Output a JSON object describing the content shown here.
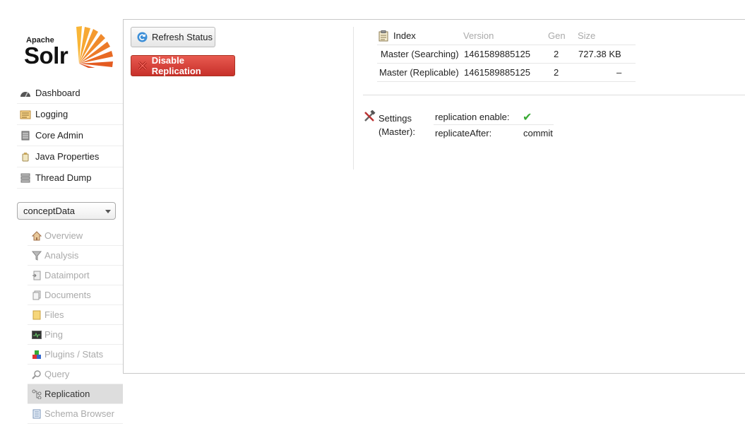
{
  "logo": {
    "apache": "Apache",
    "solr": "Solr"
  },
  "menu": [
    {
      "label": "Dashboard",
      "icon": "dashboard-icon"
    },
    {
      "label": "Logging",
      "icon": "logging-icon"
    },
    {
      "label": "Core Admin",
      "icon": "core-admin-icon"
    },
    {
      "label": "Java Properties",
      "icon": "java-properties-icon"
    },
    {
      "label": "Thread Dump",
      "icon": "thread-dump-icon"
    }
  ],
  "core_selector": {
    "value": "conceptData"
  },
  "core_menu": [
    {
      "label": "Overview",
      "icon": "home-icon"
    },
    {
      "label": "Analysis",
      "icon": "funnel-icon"
    },
    {
      "label": "Dataimport",
      "icon": "dataimport-icon"
    },
    {
      "label": "Documents",
      "icon": "documents-icon"
    },
    {
      "label": "Files",
      "icon": "folder-icon"
    },
    {
      "label": "Ping",
      "icon": "ping-icon"
    },
    {
      "label": "Plugins / Stats",
      "icon": "plugins-icon"
    },
    {
      "label": "Query",
      "icon": "search-icon"
    },
    {
      "label": "Replication",
      "icon": "replication-icon",
      "active": true
    },
    {
      "label": "Schema Browser",
      "icon": "schema-icon"
    }
  ],
  "buttons": {
    "refresh": "Refresh Status",
    "disable": "Disable Replication"
  },
  "index_table": {
    "headers": {
      "index": "Index",
      "version": "Version",
      "gen": "Gen",
      "size": "Size"
    },
    "rows": [
      {
        "label": "Master (Searching)",
        "version": "1461589885125",
        "gen": "2",
        "size": "727.38 KB"
      },
      {
        "label": "Master (Replicable)",
        "version": "1461589885125",
        "gen": "2",
        "size": "–"
      }
    ]
  },
  "settings": {
    "title_line1": "Settings",
    "title_line2": "(Master):",
    "replication_enable_label": "replication enable:",
    "replication_enable_value": "✔",
    "replicate_after_label": "replicateAfter:",
    "replicate_after_value": "commit"
  },
  "colors": {
    "danger": "#d03a32",
    "check": "#3aaa35"
  }
}
